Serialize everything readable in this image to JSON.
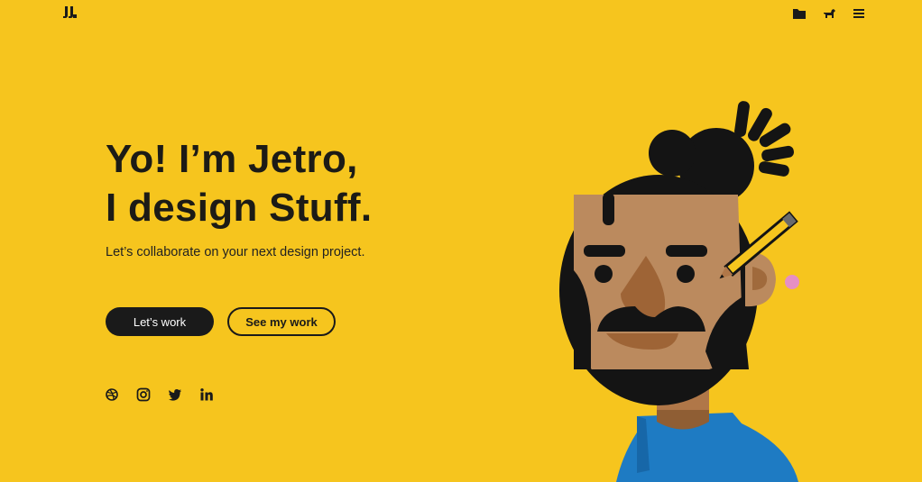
{
  "header": {
    "logo_icon": "jj-logo-icon",
    "nav_icons": [
      "folder-icon",
      "dog-icon",
      "menu-icon"
    ]
  },
  "hero": {
    "title_line1": "Yo! I’m Jetro,",
    "title_line2": "I design Stuff.",
    "subtitle": "Let’s collaborate  on your next design project."
  },
  "actions": {
    "primary_label": "Let’s work",
    "secondary_label": "See my work"
  },
  "social": {
    "icons": [
      "dribbble-icon",
      "instagram-icon",
      "twitter-icon",
      "linkedin-icon"
    ]
  },
  "colors": {
    "background": "#F6C51E",
    "dark": "#1A1A1A",
    "skin": "#BB8A5E",
    "nose": "#9E6436",
    "shirt": "#1E7BC3"
  }
}
